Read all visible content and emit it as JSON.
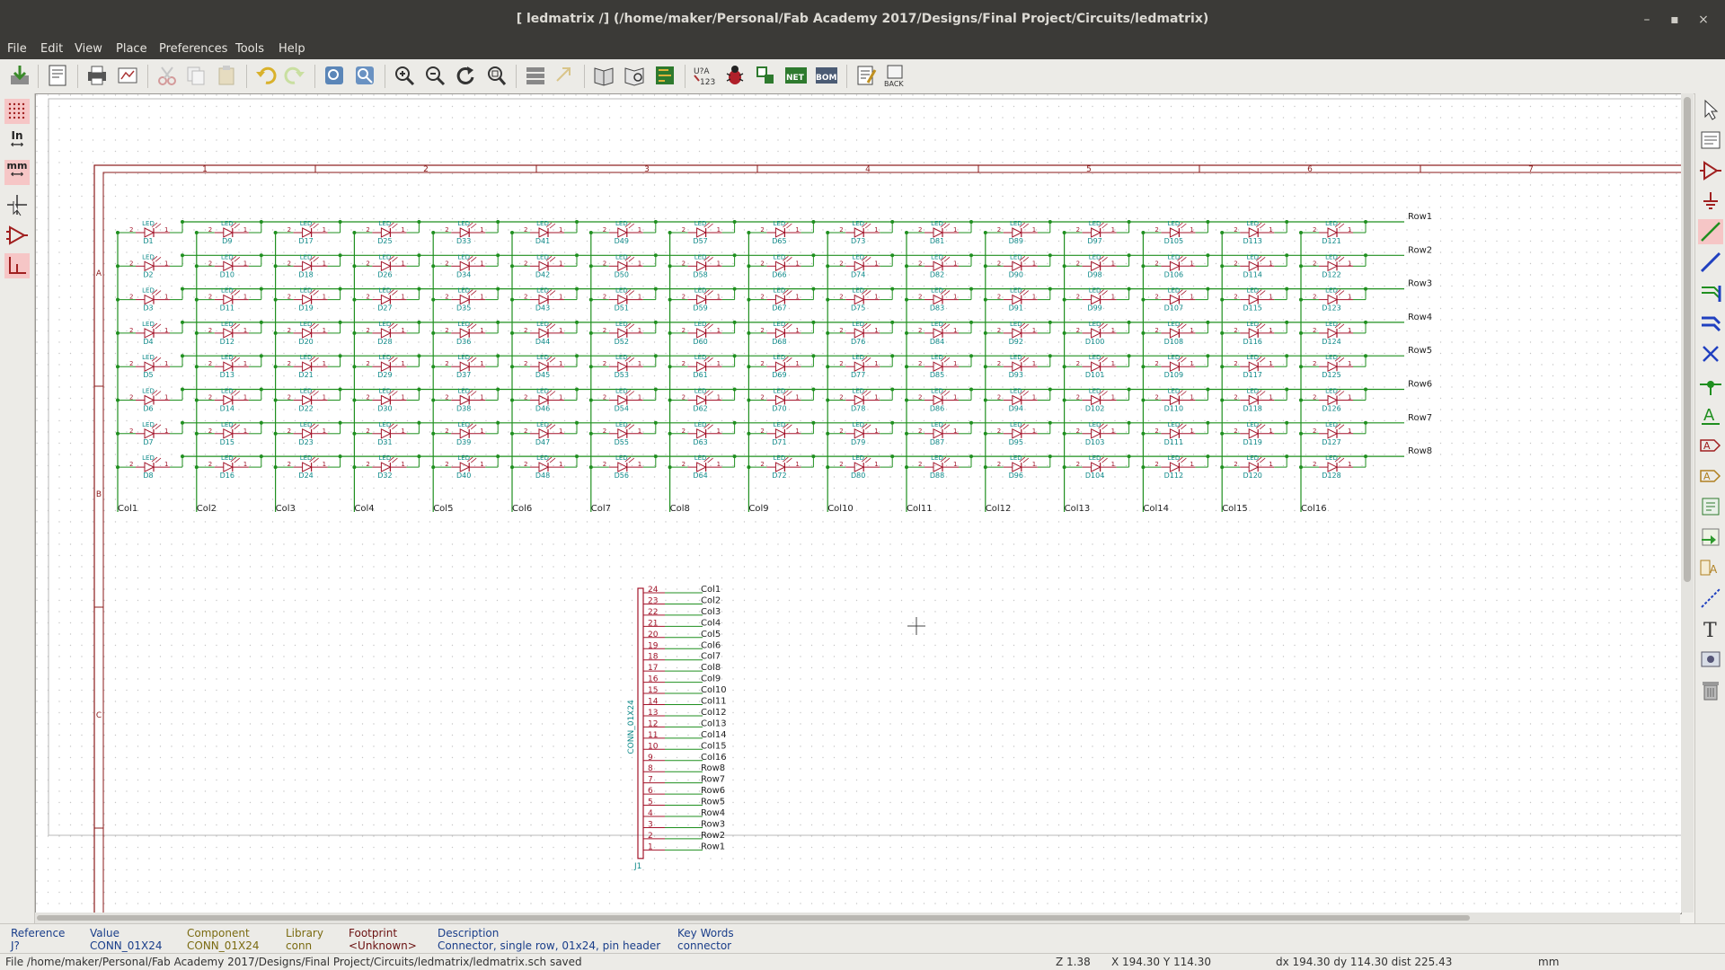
{
  "window": {
    "title": "[ ledmatrix /] (/home/maker/Personal/Fab Academy 2017/Designs/Final Project/Circuits/ledmatrix)",
    "minimize": "–",
    "maximize": "▪",
    "close": "×"
  },
  "menu": [
    "File",
    "Edit",
    "View",
    "Place",
    "Preferences",
    "Tools",
    "Help"
  ],
  "left_toolbar": {
    "units_in": "In",
    "units_mm": "mm"
  },
  "schematic": {
    "frame_columns": [
      "1",
      "2",
      "3",
      "4",
      "5",
      "6",
      "7"
    ],
    "frame_rows": [
      "A",
      "B",
      "C"
    ],
    "led_value": "LED",
    "pin_a": "2",
    "pin_k": "1",
    "row_labels": [
      "Row1",
      "Row2",
      "Row3",
      "Row4",
      "Row5",
      "Row6",
      "Row7",
      "Row8"
    ],
    "col_labels": [
      "Col1",
      "Col2",
      "Col3",
      "Col4",
      "Col5",
      "Col6",
      "Col7",
      "Col8",
      "Col9",
      "Col10",
      "Col11",
      "Col12",
      "Col13",
      "Col14",
      "Col15",
      "Col16"
    ],
    "connector": {
      "reference": "J1",
      "value": "CONN_01X24",
      "pins": [
        {
          "num": "24",
          "net": "Col1"
        },
        {
          "num": "23",
          "net": "Col2"
        },
        {
          "num": "22",
          "net": "Col3"
        },
        {
          "num": "21",
          "net": "Col4"
        },
        {
          "num": "20",
          "net": "Col5"
        },
        {
          "num": "19",
          "net": "Col6"
        },
        {
          "num": "18",
          "net": "Col7"
        },
        {
          "num": "17",
          "net": "Col8"
        },
        {
          "num": "16",
          "net": "Col9"
        },
        {
          "num": "15",
          "net": "Col10"
        },
        {
          "num": "14",
          "net": "Col11"
        },
        {
          "num": "13",
          "net": "Col12"
        },
        {
          "num": "12",
          "net": "Col13"
        },
        {
          "num": "11",
          "net": "Col14"
        },
        {
          "num": "10",
          "net": "Col15"
        },
        {
          "num": "9",
          "net": "Col16"
        },
        {
          "num": "8",
          "net": "Row8"
        },
        {
          "num": "7",
          "net": "Row7"
        },
        {
          "num": "6",
          "net": "Row6"
        },
        {
          "num": "5",
          "net": "Row5"
        },
        {
          "num": "4",
          "net": "Row4"
        },
        {
          "num": "3",
          "net": "Row3"
        },
        {
          "num": "2",
          "net": "Row2"
        },
        {
          "num": "1",
          "net": "Row1"
        }
      ]
    },
    "colors": {
      "wire": "#1f8f1f",
      "part": "#a3142a",
      "label": "#0f8a8a",
      "frame": "#8b1a1a",
      "junction": "#1f8f1f"
    }
  },
  "info": {
    "reference": {
      "label": "Reference",
      "value": "J?"
    },
    "value": {
      "label": "Value",
      "value": "CONN_01X24"
    },
    "component": {
      "label": "Component",
      "value": "CONN_01X24"
    },
    "library": {
      "label": "Library",
      "value": "conn"
    },
    "footprint": {
      "label": "Footprint",
      "value": "<Unknown>"
    },
    "description": {
      "label": "Description",
      "value": "Connector, single row, 01x24, pin header"
    },
    "keywords": {
      "label": "Key Words",
      "value": "connector"
    }
  },
  "status": {
    "message": "File /home/maker/Personal/Fab Academy 2017/Designs/Final Project/Circuits/ledmatrix/ledmatrix.sch saved",
    "zoom": "Z 1.38",
    "xy": "X 194.30  Y 114.30",
    "delta": "dx 194.30  dy 114.30  dist 225.43",
    "units": "mm"
  }
}
